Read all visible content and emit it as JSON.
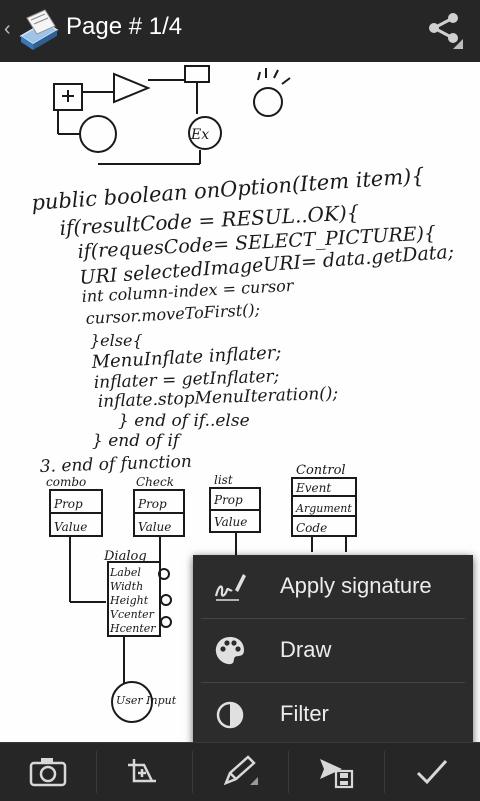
{
  "header": {
    "title": "Page # 1/4",
    "app_icon": "scanner-app-icon",
    "share_icon": "share-icon"
  },
  "document": {
    "handwriting_lines": [
      "public boolean onOption(Item item){",
      "if(resultCode = RESUL..OK){",
      "if(requesCode= SELECT_PICTURE){",
      "URI selectedImageURI= data.getData;",
      "int column-index = cursor",
      "cursor.moveToFirst();",
      "}else{",
      "MenuInflate inflater;",
      "inflater = getInflater;",
      "inflate.stopMenuIteration();",
      "} end of if..else",
      "} end of if",
      "3. end of function"
    ],
    "boxes": [
      {
        "title": "combo",
        "rows": [
          "Prop",
          "Value"
        ]
      },
      {
        "title": "Check",
        "rows": [
          "Prop",
          "Value"
        ]
      },
      {
        "title": "list",
        "rows": [
          "Prop",
          "Value"
        ]
      },
      {
        "title": "Control",
        "rows": [
          "Event",
          "Argument",
          "Code"
        ]
      }
    ],
    "dialog_box": {
      "title": "Dialog",
      "rows": [
        "Label",
        "Width",
        "Height",
        "Vcenter",
        "Hcenter"
      ]
    },
    "user_input": "User Input",
    "ex_node": "Ex"
  },
  "menu": {
    "items": [
      {
        "label": "Apply signature",
        "icon": "signature-icon"
      },
      {
        "label": "Draw",
        "icon": "palette-icon"
      },
      {
        "label": "Filter",
        "icon": "contrast-filter-icon"
      }
    ]
  },
  "toolbar": {
    "items": [
      {
        "icon": "camera-icon"
      },
      {
        "icon": "crop-icon"
      },
      {
        "icon": "pencil-icon"
      },
      {
        "icon": "send-save-icon"
      },
      {
        "icon": "checkmark-icon"
      }
    ]
  },
  "colors": {
    "action_bar": "#262626",
    "menu_background": "#2c2c2c",
    "text_light": "#ececec",
    "ink": "#1a1a1a"
  }
}
